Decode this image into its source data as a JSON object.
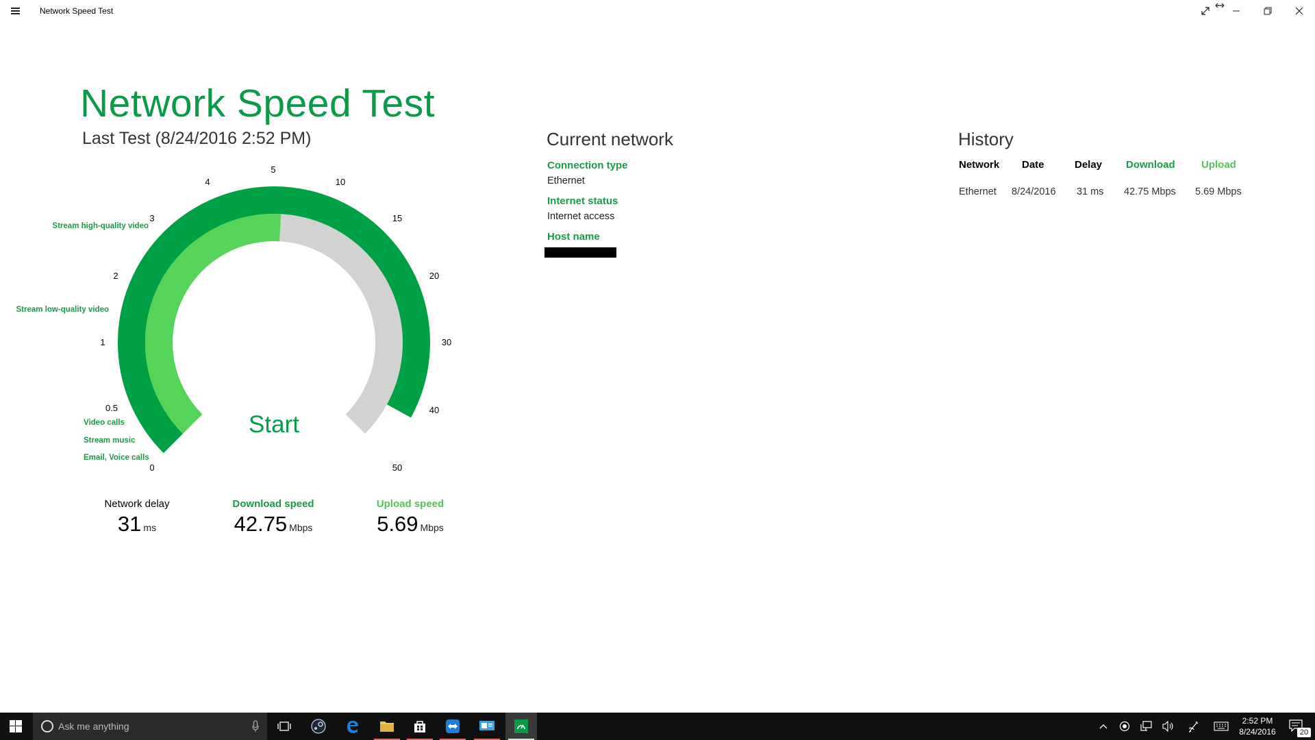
{
  "window": {
    "title": "Network Speed Test"
  },
  "header": {
    "title": "Network Speed Test",
    "last_test": "Last Test (8/24/2016 2:52 PM)"
  },
  "gauge": {
    "ticks": [
      "0",
      "0.5",
      "1",
      "2",
      "3",
      "4",
      "5",
      "10",
      "15",
      "20",
      "30",
      "40",
      "50"
    ],
    "indicators": [
      "Stream high-quality video",
      "Stream low-quality video",
      "Video calls",
      "Stream music",
      "Email, Voice calls"
    ],
    "download_mbps": 42.75,
    "upload_mbps": 5.69,
    "start_label": "Start",
    "colors": {
      "download": "#00a044",
      "upload": "#56d45a",
      "track": "#d0d3cf"
    }
  },
  "stats": {
    "delay": {
      "label": "Network delay",
      "value": "31",
      "unit": "ms"
    },
    "download": {
      "label": "Download speed",
      "value": "42.75",
      "unit": "Mbps"
    },
    "upload": {
      "label": "Upload speed",
      "value": "5.69",
      "unit": "Mbps"
    }
  },
  "network": {
    "heading": "Current network",
    "connection_type_label": "Connection type",
    "connection_type": "Ethernet",
    "internet_status_label": "Internet status",
    "internet_status": "Internet access",
    "host_name_label": "Host name"
  },
  "history": {
    "heading": "History",
    "columns": [
      "Network",
      "Date",
      "Delay",
      "Download",
      "Upload"
    ],
    "rows": [
      [
        "Ethernet",
        "8/24/2016",
        "31 ms",
        "42.75 Mbps",
        "5.69 Mbps"
      ]
    ]
  },
  "taskbar": {
    "search_placeholder": "Ask me anything",
    "time": "2:52 PM",
    "date": "8/24/2016",
    "notifications": "20"
  },
  "colors": {
    "accent": "#0b9a4a",
    "label_green": "#1c9a4a",
    "upload_green": "#56c25a"
  }
}
